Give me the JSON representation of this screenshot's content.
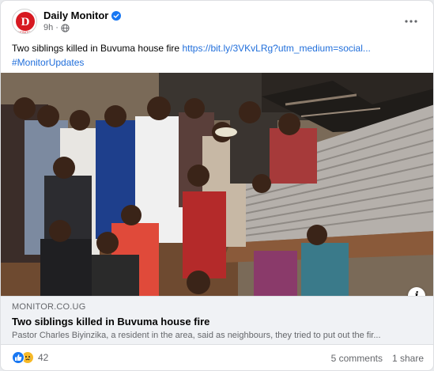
{
  "post": {
    "page_name": "Daily Monitor",
    "time": "9h",
    "verified_icon": "verified-badge-icon",
    "privacy_icon": "globe-icon",
    "more_icon": "more-options-icon",
    "avatar_letter": "D",
    "avatar_caption": "MONITOR",
    "text_main": "Two siblings killed in Buvuma house fire ",
    "link_text": "https://bit.ly/3VKvLRg?utm_medium=social...",
    "hashtag": "#MonitorUpdates"
  },
  "link_preview": {
    "domain": "MONITOR.CO.UG",
    "title": "Two siblings killed in Buvuma house fire",
    "description": "Pastor Charles Biyinzika, a resident in the area, said as neighbours, they tried to put out the fir..."
  },
  "footer": {
    "reaction_count": "42",
    "comments": "5 comments",
    "shares": "1 share"
  },
  "colors": {
    "brand_red": "#d71921",
    "link_blue": "#216fdb",
    "like_blue": "#1877f2",
    "sad_yellow": "#f7b928"
  }
}
